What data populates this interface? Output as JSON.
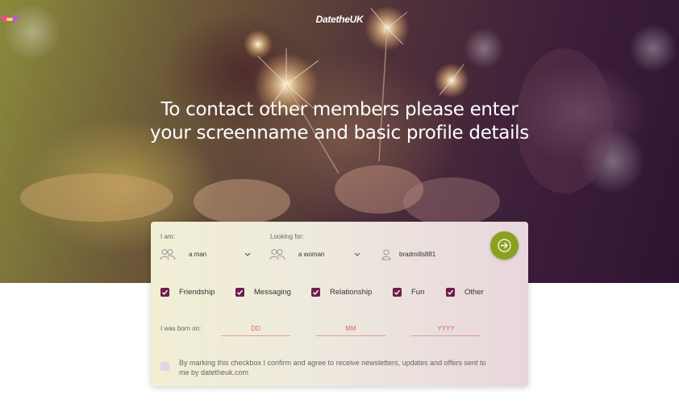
{
  "brand": {
    "name": "DatetheUK"
  },
  "headline": "To contact other members please enter your screenname and basic profile details",
  "form": {
    "i_am": {
      "label": "I am:",
      "value": "a man"
    },
    "looking_for": {
      "label": "Looking for:",
      "value": "a woman"
    },
    "screenname": {
      "value": "bradmills881"
    },
    "submit_icon": "arrow-right-icon",
    "interests": [
      {
        "label": "Friendship",
        "checked": true
      },
      {
        "label": "Messaging",
        "checked": true
      },
      {
        "label": "Relationship",
        "checked": true
      },
      {
        "label": "Fun",
        "checked": true
      },
      {
        "label": "Other",
        "checked": true
      }
    ],
    "dob": {
      "label": "I was born on:",
      "day_placeholder": "DD",
      "month_placeholder": "MM",
      "year_placeholder": "YYYY"
    },
    "newsletter": {
      "checked": false,
      "text": "By marking this checkbox I confirm and agree to receive newsletters, updates and offers sent to me by datetheuk.com"
    }
  },
  "colors": {
    "accent_green": "#8aa11e",
    "checkbox_purple": "#6e1e4a",
    "placeholder_red": "#d66a5c"
  }
}
